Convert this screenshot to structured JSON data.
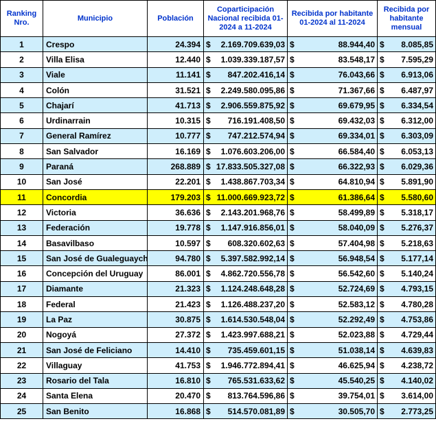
{
  "headers": {
    "ranking": "Ranking Nro.",
    "municipio": "Municipio",
    "poblacion": "Población",
    "coparticipacion": "Coparticipación Nacional recibida 01-2024 a 11-2024",
    "por_habitante": "Recibida por habitante 01-2024 al 11-2024",
    "mensual": "Recibida por habitante mensual"
  },
  "currency_symbol": "$",
  "colors": {
    "header_text": "#0033cc",
    "stripe": "#cfeefc",
    "highlight": "#ffff00"
  },
  "rows": [
    {
      "rank": "1",
      "municipio": "Crespo",
      "poblacion": "24.394",
      "copart": "2.169.709.639,03",
      "por_hab": "88.944,40",
      "mensual": "8.085,85"
    },
    {
      "rank": "2",
      "municipio": "Villa Elisa",
      "poblacion": "12.440",
      "copart": "1.039.339.187,57",
      "por_hab": "83.548,17",
      "mensual": "7.595,29"
    },
    {
      "rank": "3",
      "municipio": "Viale",
      "poblacion": "11.141",
      "copart": "847.202.416,14",
      "por_hab": "76.043,66",
      "mensual": "6.913,06"
    },
    {
      "rank": "4",
      "municipio": "Colón",
      "poblacion": "31.521",
      "copart": "2.249.580.095,86",
      "por_hab": "71.367,66",
      "mensual": "6.487,97"
    },
    {
      "rank": "5",
      "municipio": "Chajarí",
      "poblacion": "41.713",
      "copart": "2.906.559.875,92",
      "por_hab": "69.679,95",
      "mensual": "6.334,54"
    },
    {
      "rank": "6",
      "municipio": "Urdinarrain",
      "poblacion": "10.315",
      "copart": "716.191.408,50",
      "por_hab": "69.432,03",
      "mensual": "6.312,00"
    },
    {
      "rank": "7",
      "municipio": "General Ramírez",
      "poblacion": "10.777",
      "copart": "747.212.574,94",
      "por_hab": "69.334,01",
      "mensual": "6.303,09"
    },
    {
      "rank": "8",
      "municipio": "San Salvador",
      "poblacion": "16.169",
      "copart": "1.076.603.206,00",
      "por_hab": "66.584,40",
      "mensual": "6.053,13"
    },
    {
      "rank": "9",
      "municipio": "Paraná",
      "poblacion": "268.889",
      "copart": "17.833.505.327,08",
      "por_hab": "66.322,93",
      "mensual": "6.029,36"
    },
    {
      "rank": "10",
      "municipio": "San José",
      "poblacion": "22.201",
      "copart": "1.438.867.703,34",
      "por_hab": "64.810,94",
      "mensual": "5.891,90"
    },
    {
      "rank": "11",
      "municipio": "Concordia",
      "poblacion": "179.203",
      "copart": "11.000.669.923,72",
      "por_hab": "61.386,64",
      "mensual": "5.580,60"
    },
    {
      "rank": "12",
      "municipio": "Victoria",
      "poblacion": "36.636",
      "copart": "2.143.201.968,76",
      "por_hab": "58.499,89",
      "mensual": "5.318,17"
    },
    {
      "rank": "13",
      "municipio": "Federación",
      "poblacion": "19.778",
      "copart": "1.147.916.856,01",
      "por_hab": "58.040,09",
      "mensual": "5.276,37"
    },
    {
      "rank": "14",
      "municipio": "Basavilbaso",
      "poblacion": "10.597",
      "copart": "608.320.602,63",
      "por_hab": "57.404,98",
      "mensual": "5.218,63"
    },
    {
      "rank": "15",
      "municipio": "San José de Gualeguaychú",
      "poblacion": "94.780",
      "copart": "5.397.582.992,14",
      "por_hab": "56.948,54",
      "mensual": "5.177,14"
    },
    {
      "rank": "16",
      "municipio": "Concepción del Uruguay",
      "poblacion": "86.001",
      "copart": "4.862.720.556,78",
      "por_hab": "56.542,60",
      "mensual": "5.140,24"
    },
    {
      "rank": "17",
      "municipio": "Diamante",
      "poblacion": "21.323",
      "copart": "1.124.248.648,28",
      "por_hab": "52.724,69",
      "mensual": "4.793,15"
    },
    {
      "rank": "18",
      "municipio": "Federal",
      "poblacion": "21.423",
      "copart": "1.126.488.237,20",
      "por_hab": "52.583,12",
      "mensual": "4.780,28"
    },
    {
      "rank": "19",
      "municipio": "La Paz",
      "poblacion": "30.875",
      "copart": "1.614.530.548,04",
      "por_hab": "52.292,49",
      "mensual": "4.753,86"
    },
    {
      "rank": "20",
      "municipio": "Nogoyá",
      "poblacion": "27.372",
      "copart": "1.423.997.688,21",
      "por_hab": "52.023,88",
      "mensual": "4.729,44"
    },
    {
      "rank": "21",
      "municipio": "San José de Feliciano",
      "poblacion": "14.410",
      "copart": "735.459.601,15",
      "por_hab": "51.038,14",
      "mensual": "4.639,83"
    },
    {
      "rank": "22",
      "municipio": "Villaguay",
      "poblacion": "41.753",
      "copart": "1.946.772.894,41",
      "por_hab": "46.625,94",
      "mensual": "4.238,72"
    },
    {
      "rank": "23",
      "municipio": "Rosario del Tala",
      "poblacion": "16.810",
      "copart": "765.531.633,62",
      "por_hab": "45.540,25",
      "mensual": "4.140,02"
    },
    {
      "rank": "24",
      "municipio": "Santa Elena",
      "poblacion": "20.470",
      "copart": "813.764.596,86",
      "por_hab": "39.754,01",
      "mensual": "3.614,00"
    },
    {
      "rank": "25",
      "municipio": "San Benito",
      "poblacion": "16.868",
      "copart": "514.570.081,89",
      "por_hab": "30.505,70",
      "mensual": "2.773,25"
    }
  ]
}
